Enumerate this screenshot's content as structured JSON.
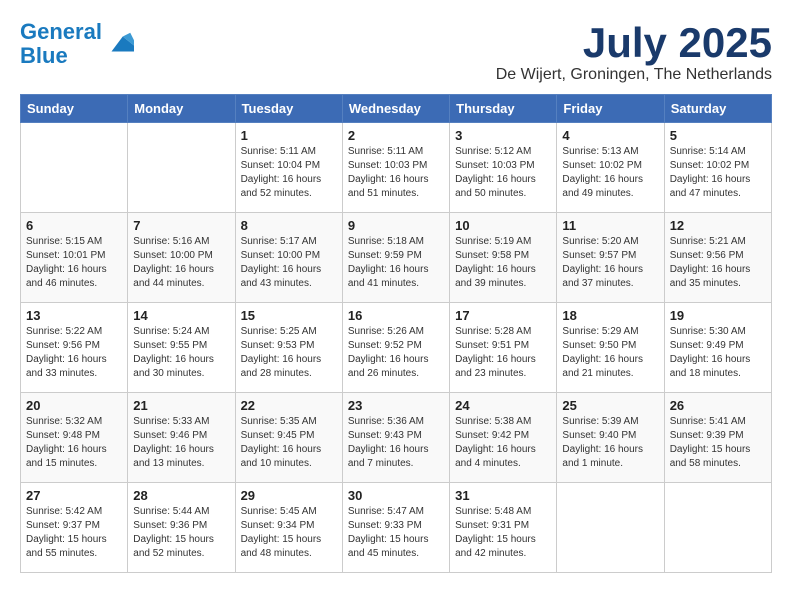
{
  "header": {
    "logo_line1": "General",
    "logo_line2": "Blue",
    "month": "July 2025",
    "location": "De Wijert, Groningen, The Netherlands"
  },
  "weekdays": [
    "Sunday",
    "Monday",
    "Tuesday",
    "Wednesday",
    "Thursday",
    "Friday",
    "Saturday"
  ],
  "weeks": [
    [
      {
        "day": "",
        "info": ""
      },
      {
        "day": "",
        "info": ""
      },
      {
        "day": "1",
        "info": "Sunrise: 5:11 AM\nSunset: 10:04 PM\nDaylight: 16 hours\nand 52 minutes."
      },
      {
        "day": "2",
        "info": "Sunrise: 5:11 AM\nSunset: 10:03 PM\nDaylight: 16 hours\nand 51 minutes."
      },
      {
        "day": "3",
        "info": "Sunrise: 5:12 AM\nSunset: 10:03 PM\nDaylight: 16 hours\nand 50 minutes."
      },
      {
        "day": "4",
        "info": "Sunrise: 5:13 AM\nSunset: 10:02 PM\nDaylight: 16 hours\nand 49 minutes."
      },
      {
        "day": "5",
        "info": "Sunrise: 5:14 AM\nSunset: 10:02 PM\nDaylight: 16 hours\nand 47 minutes."
      }
    ],
    [
      {
        "day": "6",
        "info": "Sunrise: 5:15 AM\nSunset: 10:01 PM\nDaylight: 16 hours\nand 46 minutes."
      },
      {
        "day": "7",
        "info": "Sunrise: 5:16 AM\nSunset: 10:00 PM\nDaylight: 16 hours\nand 44 minutes."
      },
      {
        "day": "8",
        "info": "Sunrise: 5:17 AM\nSunset: 10:00 PM\nDaylight: 16 hours\nand 43 minutes."
      },
      {
        "day": "9",
        "info": "Sunrise: 5:18 AM\nSunset: 9:59 PM\nDaylight: 16 hours\nand 41 minutes."
      },
      {
        "day": "10",
        "info": "Sunrise: 5:19 AM\nSunset: 9:58 PM\nDaylight: 16 hours\nand 39 minutes."
      },
      {
        "day": "11",
        "info": "Sunrise: 5:20 AM\nSunset: 9:57 PM\nDaylight: 16 hours\nand 37 minutes."
      },
      {
        "day": "12",
        "info": "Sunrise: 5:21 AM\nSunset: 9:56 PM\nDaylight: 16 hours\nand 35 minutes."
      }
    ],
    [
      {
        "day": "13",
        "info": "Sunrise: 5:22 AM\nSunset: 9:56 PM\nDaylight: 16 hours\nand 33 minutes."
      },
      {
        "day": "14",
        "info": "Sunrise: 5:24 AM\nSunset: 9:55 PM\nDaylight: 16 hours\nand 30 minutes."
      },
      {
        "day": "15",
        "info": "Sunrise: 5:25 AM\nSunset: 9:53 PM\nDaylight: 16 hours\nand 28 minutes."
      },
      {
        "day": "16",
        "info": "Sunrise: 5:26 AM\nSunset: 9:52 PM\nDaylight: 16 hours\nand 26 minutes."
      },
      {
        "day": "17",
        "info": "Sunrise: 5:28 AM\nSunset: 9:51 PM\nDaylight: 16 hours\nand 23 minutes."
      },
      {
        "day": "18",
        "info": "Sunrise: 5:29 AM\nSunset: 9:50 PM\nDaylight: 16 hours\nand 21 minutes."
      },
      {
        "day": "19",
        "info": "Sunrise: 5:30 AM\nSunset: 9:49 PM\nDaylight: 16 hours\nand 18 minutes."
      }
    ],
    [
      {
        "day": "20",
        "info": "Sunrise: 5:32 AM\nSunset: 9:48 PM\nDaylight: 16 hours\nand 15 minutes."
      },
      {
        "day": "21",
        "info": "Sunrise: 5:33 AM\nSunset: 9:46 PM\nDaylight: 16 hours\nand 13 minutes."
      },
      {
        "day": "22",
        "info": "Sunrise: 5:35 AM\nSunset: 9:45 PM\nDaylight: 16 hours\nand 10 minutes."
      },
      {
        "day": "23",
        "info": "Sunrise: 5:36 AM\nSunset: 9:43 PM\nDaylight: 16 hours\nand 7 minutes."
      },
      {
        "day": "24",
        "info": "Sunrise: 5:38 AM\nSunset: 9:42 PM\nDaylight: 16 hours\nand 4 minutes."
      },
      {
        "day": "25",
        "info": "Sunrise: 5:39 AM\nSunset: 9:40 PM\nDaylight: 16 hours\nand 1 minute."
      },
      {
        "day": "26",
        "info": "Sunrise: 5:41 AM\nSunset: 9:39 PM\nDaylight: 15 hours\nand 58 minutes."
      }
    ],
    [
      {
        "day": "27",
        "info": "Sunrise: 5:42 AM\nSunset: 9:37 PM\nDaylight: 15 hours\nand 55 minutes."
      },
      {
        "day": "28",
        "info": "Sunrise: 5:44 AM\nSunset: 9:36 PM\nDaylight: 15 hours\nand 52 minutes."
      },
      {
        "day": "29",
        "info": "Sunrise: 5:45 AM\nSunset: 9:34 PM\nDaylight: 15 hours\nand 48 minutes."
      },
      {
        "day": "30",
        "info": "Sunrise: 5:47 AM\nSunset: 9:33 PM\nDaylight: 15 hours\nand 45 minutes."
      },
      {
        "day": "31",
        "info": "Sunrise: 5:48 AM\nSunset: 9:31 PM\nDaylight: 15 hours\nand 42 minutes."
      },
      {
        "day": "",
        "info": ""
      },
      {
        "day": "",
        "info": ""
      }
    ]
  ]
}
